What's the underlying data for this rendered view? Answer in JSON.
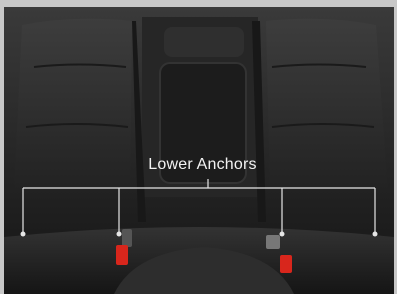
{
  "image": {
    "subject": "rear-seat",
    "annotation": {
      "label": "Lower Anchors",
      "line_color": "#e6e6e6",
      "anchor_count": 4
    },
    "colors": {
      "upholstery": "#2b2b2b",
      "buckle_accent": "#d8261c",
      "frame": "#c8c8c8"
    }
  }
}
